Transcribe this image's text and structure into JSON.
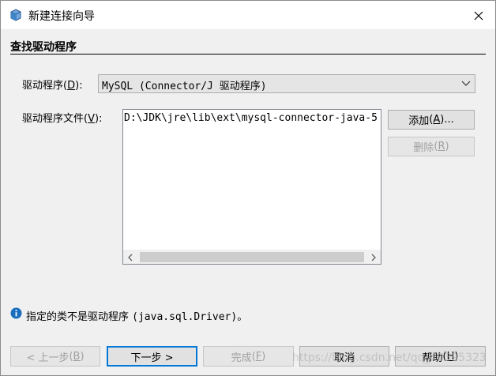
{
  "window": {
    "title": "新建连接向导",
    "icon": "database-icon",
    "close_icon": "close-icon"
  },
  "section": {
    "title": "查找驱动程序"
  },
  "driver": {
    "label": "驱动程序",
    "label_mnemonic": "D",
    "label_suffix": ":",
    "selected": "MySQL (Connector/J 驱动程序)"
  },
  "driver_files": {
    "label": "驱动程序文件",
    "label_mnemonic": "V",
    "label_suffix": ":",
    "items": [
      "D:\\JDK\\jre\\lib\\ext\\mysql-connector-java-5"
    ]
  },
  "side_buttons": {
    "add": {
      "text": "添加",
      "mnemonic": "A",
      "suffix": "..."
    },
    "remove": {
      "text": "删除",
      "mnemonic": "R",
      "suffix": ""
    }
  },
  "status": {
    "icon": "info-icon",
    "text": "指定的类不是驱动程序 ",
    "code": "(java.sql.Driver)",
    "end": "。"
  },
  "buttons": {
    "back": {
      "text": "< 上一步",
      "mnemonic": "B"
    },
    "next": {
      "text": "下一步 >"
    },
    "finish": {
      "text": "完成",
      "mnemonic": "F"
    },
    "cancel": {
      "text": "取消"
    },
    "help": {
      "text": "帮助",
      "mnemonic": "H"
    }
  },
  "watermark": "https://blog.csdn.net/qq_40395323",
  "colors": {
    "accent": "#0078d7",
    "background": "#f0f0f0",
    "info_blue": "#1a6ebd"
  }
}
